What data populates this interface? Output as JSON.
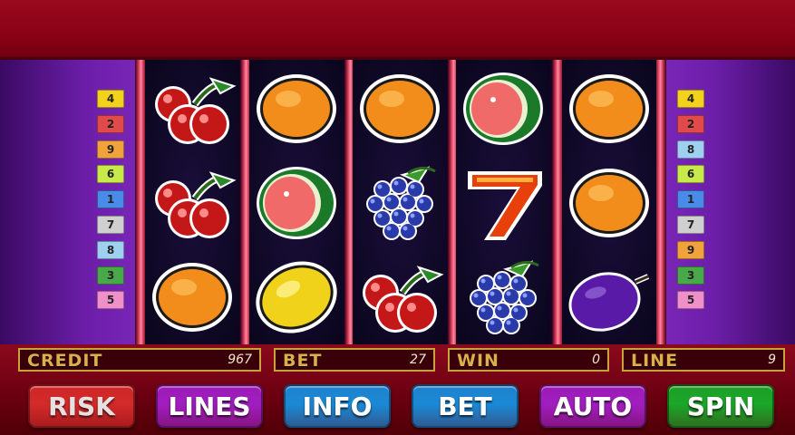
{
  "game": {
    "reels": [
      [
        "cherries-icon",
        "cherries-icon",
        "orange-icon"
      ],
      [
        "orange-icon",
        "watermelon-icon",
        "lemon-icon"
      ],
      [
        "orange-icon",
        "grapes-icon",
        "cherries-icon"
      ],
      [
        "watermelon-icon",
        "seven-icon",
        "grapes-icon"
      ],
      [
        "orange-icon",
        "orange-icon",
        "plum-icon"
      ]
    ],
    "left_lines": [
      {
        "n": "4",
        "color": "#f2d21a"
      },
      {
        "n": "2",
        "color": "#e04a4a"
      },
      {
        "n": "9",
        "color": "#f0a33a"
      },
      {
        "n": "6",
        "color": "#c9e84a"
      },
      {
        "n": "1",
        "color": "#4a8ae8"
      },
      {
        "n": "7",
        "color": "#cfcfcf"
      },
      {
        "n": "8",
        "color": "#9fd0f0"
      },
      {
        "n": "3",
        "color": "#4aa84a"
      },
      {
        "n": "5",
        "color": "#f090c8"
      }
    ],
    "right_lines": [
      {
        "n": "4",
        "color": "#f2d21a"
      },
      {
        "n": "2",
        "color": "#e04a4a"
      },
      {
        "n": "8",
        "color": "#9fd0f0"
      },
      {
        "n": "6",
        "color": "#c9e84a"
      },
      {
        "n": "1",
        "color": "#4a8ae8"
      },
      {
        "n": "7",
        "color": "#cfcfcf"
      },
      {
        "n": "9",
        "color": "#f0a33a"
      },
      {
        "n": "3",
        "color": "#4aa84a"
      },
      {
        "n": "5",
        "color": "#f090c8"
      }
    ]
  },
  "status": {
    "credit_label": "CREDIT",
    "credit_value": "967",
    "bet_label": "BET",
    "bet_value": "27",
    "win_label": "WIN",
    "win_value": "0",
    "line_label": "LINE",
    "line_value": "9"
  },
  "buttons": [
    {
      "label": "RISK",
      "color": "#d42a2a"
    },
    {
      "label": "LINES",
      "color": "#a01ec0"
    },
    {
      "label": "INFO",
      "color": "#1a8ad8"
    },
    {
      "label": "BET",
      "color": "#1a8ad8"
    },
    {
      "label": "AUTO",
      "color": "#a01ec0"
    },
    {
      "label": "SPIN",
      "color": "#1aa82a"
    }
  ]
}
